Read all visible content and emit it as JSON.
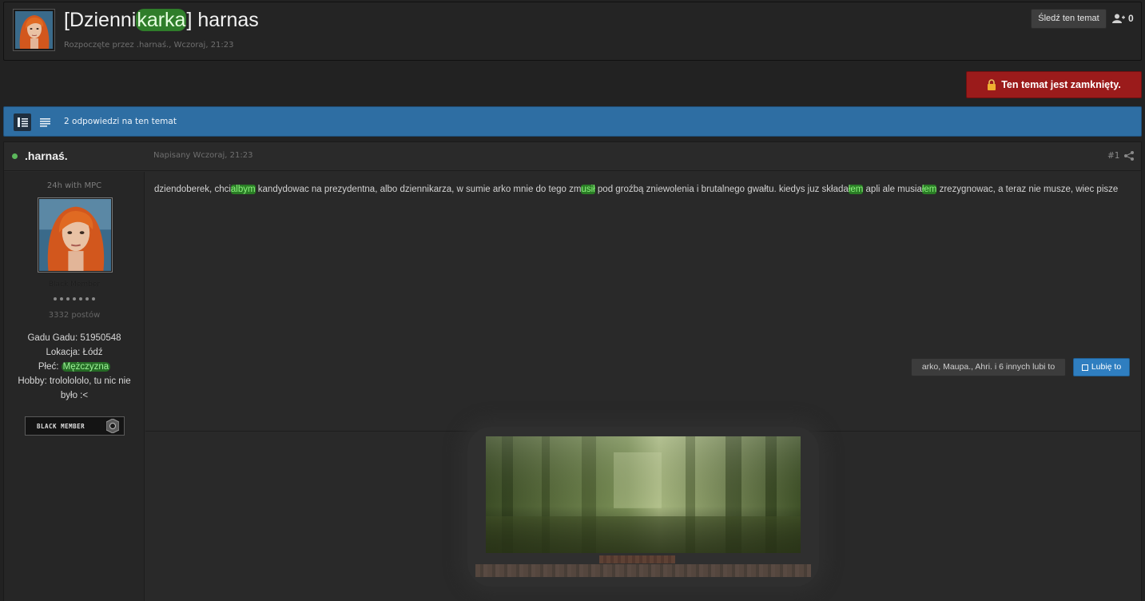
{
  "header": {
    "title_prefix": "[Dzienni",
    "title_highlight": "karka",
    "title_suffix": "] harnas",
    "meta": "Rozpoczęte przez .harnaś., Wczoraj, 21:23",
    "follow_label": "Śledź ten temat",
    "followers_count": "0"
  },
  "locked": {
    "label": "Ten temat jest zamknięty."
  },
  "topic_bar": {
    "reply_count_text": "2 odpowiedzi na ten temat"
  },
  "post": {
    "author": ".harnaś.",
    "date": "Napisany Wczoraj, 21:23",
    "number": "#1",
    "user_title": "24h with MPC",
    "group": "Black Member",
    "post_count": "3332 postów",
    "fields": {
      "gg": "Gadu Gadu: 51950548",
      "location": "Lokacja: Łódź",
      "gender_label": "Płeć: ",
      "gender_value": "Mężczyzna",
      "hobby": "Hobby: trololololo, tu nic nie było :<"
    },
    "rank_badge": "BLACK MEMBER",
    "body": {
      "p1": "dziendoberek, chci",
      "h1": "albym",
      "p2": " kandydowac na prezydentna, albo dziennikarza, w sumie arko mnie do tego zm",
      "h2": "usił",
      "p3": " pod groźbą zniewolenia i brutalnego gwałtu. kiedys juz składa",
      "h3": "łem",
      "p4": " apli ale musia",
      "h4": "łem",
      "p5": " zrezygnowac, a teraz nie musze, wiec pisze"
    },
    "likers": "arko, Maupa., Ahri. i 6 innych lubi to",
    "like_label": "Lubię to"
  },
  "colors": {
    "blue_bar": "#2e6ea3",
    "locked_red": "#9b1b1b",
    "highlight_green": "#2a7d25",
    "like_blue": "#2f7ec0"
  }
}
